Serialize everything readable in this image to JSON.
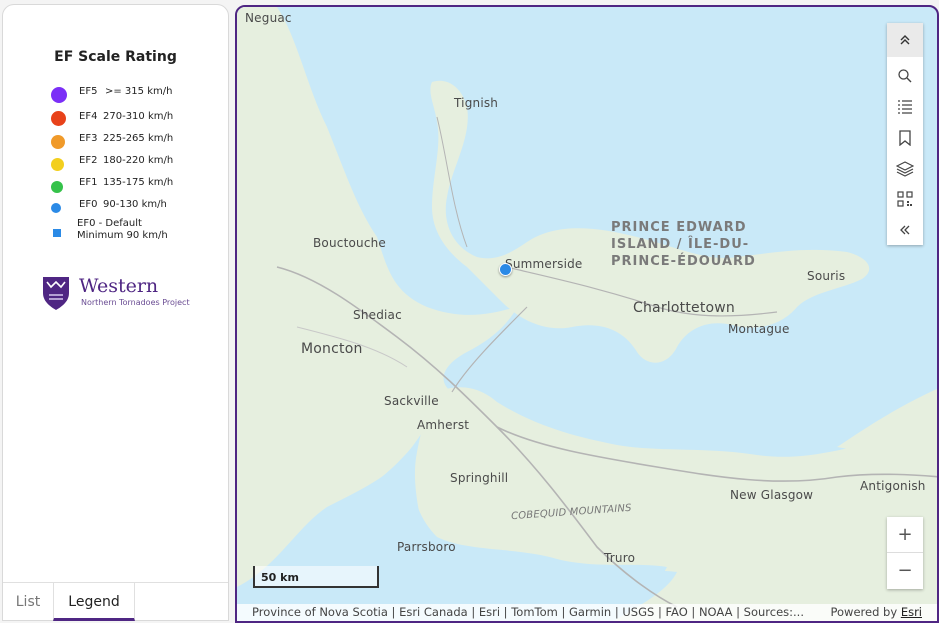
{
  "legend": {
    "title": "EF Scale Rating",
    "items": [
      {
        "rating": "EF5",
        "range": ">= 315 km/h",
        "color": "#7b2ff7"
      },
      {
        "rating": "EF4",
        "range": "270-310 km/h",
        "color": "#e8421a"
      },
      {
        "rating": "EF3",
        "range": "225-265 km/h",
        "color": "#f09a2a"
      },
      {
        "rating": "EF2",
        "range": "180-220 km/h",
        "color": "#f3cf1e"
      },
      {
        "rating": "EF1",
        "range": "135-175 km/h",
        "color": "#35c24a"
      },
      {
        "rating": "EF0",
        "range": "90-130 km/h",
        "color": "#2b8ae6"
      },
      {
        "rating": "EF0 - Default",
        "range": "Minimum 90 km/h",
        "color": "#2b8ae6"
      }
    ]
  },
  "logo": {
    "name": "Western",
    "subtitle": "Northern Tornadoes Project",
    "color": "#4f2683"
  },
  "tabs": [
    {
      "label": "List",
      "active": false
    },
    {
      "label": "Legend",
      "active": true
    }
  ],
  "map": {
    "places": {
      "neguac": "Neguac",
      "tignish": "Tignish",
      "bouctouche": "Bouctouche",
      "summerside": "Summerside",
      "pei_line1": "PRINCE EDWARD",
      "pei_line2": "ISLAND / ÎLE-DU-",
      "pei_line3": "PRINCE-ÉDOUARD",
      "souris": "Souris",
      "shediac": "Shediac",
      "charlottetown": "Charlottetown",
      "montague": "Montague",
      "moncton": "Moncton",
      "sackville": "Sackville",
      "amherst": "Amherst",
      "springhill": "Springhill",
      "cobequid": "COBEQUID MOUNTAINS",
      "new_glasgow": "New Glasgow",
      "antigonish": "Antigonish",
      "parrsboro": "Parrsboro",
      "truro": "Truro"
    },
    "scale_label": "50 km",
    "attribution": "Province of Nova Scotia | Esri Canada | Esri | TomTom | Garmin | USGS | FAO | NOAA | Sources:...",
    "powered_by_prefix": "Powered by",
    "powered_by_link": "Esri",
    "zoom_in": "+",
    "zoom_out": "−",
    "water_color": "#c9e9f8",
    "land_color": "#e6efdf",
    "accent_color": "#4f2683"
  }
}
